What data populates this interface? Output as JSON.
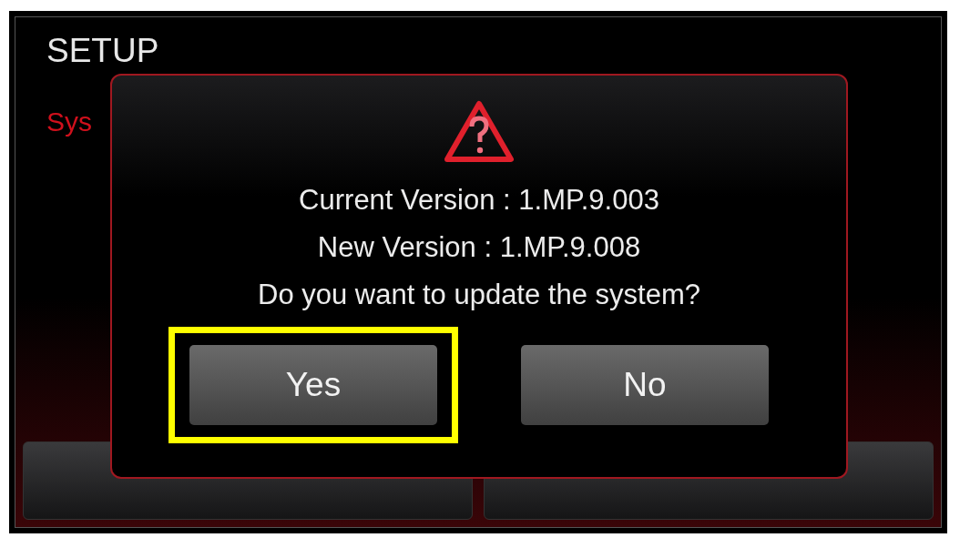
{
  "screen": {
    "title": "SETUP",
    "section": "Sys"
  },
  "dialog": {
    "lines": [
      "Current Version : 1.MP.9.003",
      "New Version : 1.MP.9.008",
      "Do you want to update the system?"
    ],
    "buttons": [
      {
        "label": "Yes",
        "highlighted": true
      },
      {
        "label": "No",
        "highlighted": false
      }
    ]
  }
}
